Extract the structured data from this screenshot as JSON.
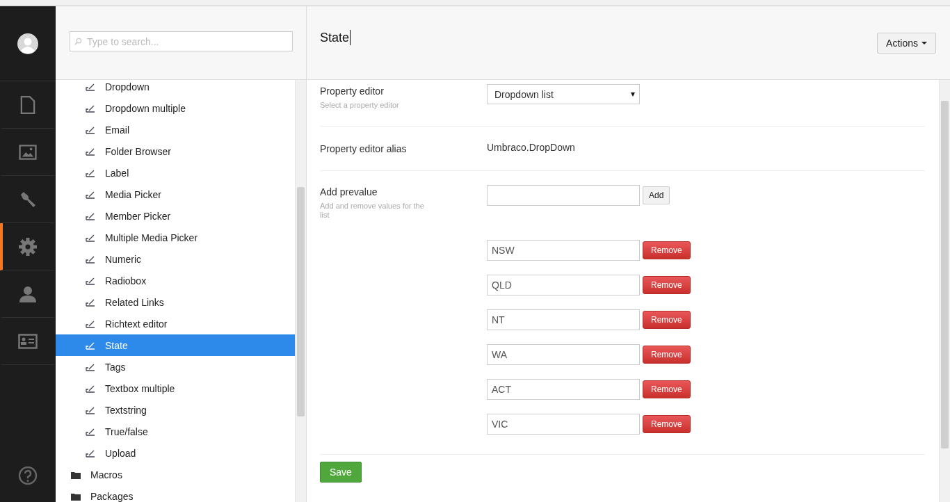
{
  "rail": {
    "items": [
      {
        "kind": "document",
        "selected": false
      },
      {
        "kind": "image",
        "selected": false
      },
      {
        "kind": "wrench",
        "selected": false
      },
      {
        "kind": "gear",
        "selected": true
      },
      {
        "kind": "person",
        "selected": false
      },
      {
        "kind": "card",
        "selected": false
      }
    ]
  },
  "tree": {
    "search": {
      "placeholder": "Type to search..."
    },
    "items": [
      {
        "label": "Dropdown",
        "kind": "datatype",
        "selected": false
      },
      {
        "label": "Dropdown multiple",
        "kind": "datatype",
        "selected": false
      },
      {
        "label": "Email",
        "kind": "datatype",
        "selected": false
      },
      {
        "label": "Folder Browser",
        "kind": "datatype",
        "selected": false
      },
      {
        "label": "Label",
        "kind": "datatype",
        "selected": false
      },
      {
        "label": "Media Picker",
        "kind": "datatype",
        "selected": false
      },
      {
        "label": "Member Picker",
        "kind": "datatype",
        "selected": false
      },
      {
        "label": "Multiple Media Picker",
        "kind": "datatype",
        "selected": false
      },
      {
        "label": "Numeric",
        "kind": "datatype",
        "selected": false
      },
      {
        "label": "Radiobox",
        "kind": "datatype",
        "selected": false
      },
      {
        "label": "Related Links",
        "kind": "datatype",
        "selected": false
      },
      {
        "label": "Richtext editor",
        "kind": "datatype",
        "selected": false
      },
      {
        "label": "State",
        "kind": "datatype",
        "selected": true
      },
      {
        "label": "Tags",
        "kind": "datatype",
        "selected": false
      },
      {
        "label": "Textbox multiple",
        "kind": "datatype",
        "selected": false
      },
      {
        "label": "Textstring",
        "kind": "datatype",
        "selected": false
      },
      {
        "label": "True/false",
        "kind": "datatype",
        "selected": false
      },
      {
        "label": "Upload",
        "kind": "datatype",
        "selected": false
      },
      {
        "label": "Macros",
        "kind": "folder",
        "selected": false
      },
      {
        "label": "Packages",
        "kind": "folder",
        "selected": false
      }
    ]
  },
  "editor": {
    "title": "State",
    "actions_button": "Actions",
    "property_editor": {
      "label": "Property editor",
      "hint": "Select a property editor",
      "value": "Dropdown list"
    },
    "alias": {
      "label": "Property editor alias",
      "value": "Umbraco.DropDown"
    },
    "prevalues": {
      "label": "Add prevalue",
      "hint": "Add and remove values for the list",
      "add_button": "Add",
      "items": [
        {
          "value": "NSW",
          "button": "Remove"
        },
        {
          "value": "QLD",
          "button": "Remove"
        },
        {
          "value": "NT",
          "button": "Remove"
        },
        {
          "value": "WA",
          "button": "Remove"
        },
        {
          "value": "ACT",
          "button": "Remove"
        },
        {
          "value": "VIC",
          "button": "Remove"
        }
      ]
    },
    "save_button": "Save"
  }
}
